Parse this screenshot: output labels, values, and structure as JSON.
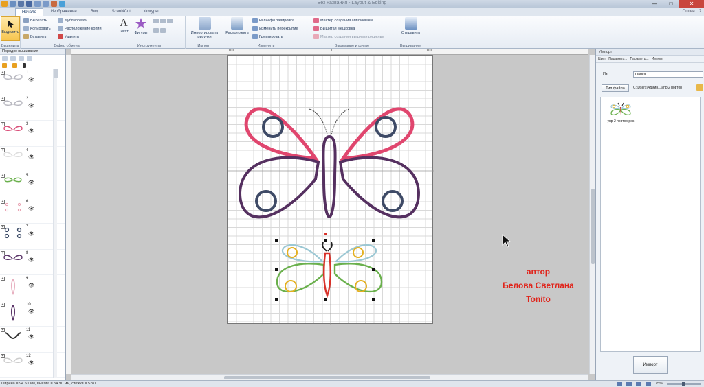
{
  "window": {
    "title": "Без названия - Layout & Editing",
    "min": "—",
    "max": "□",
    "close": "✕"
  },
  "tabs": [
    {
      "label": "Начало",
      "active": true
    },
    {
      "label": "Изображение",
      "active": false
    },
    {
      "label": "Вид",
      "active": false
    },
    {
      "label": "ScanNCut",
      "active": false
    },
    {
      "label": "Фигуры",
      "active": false
    }
  ],
  "tabs_right": {
    "options": "Опции",
    "help": "?"
  },
  "ribbon": {
    "select": {
      "label": "Выделить",
      "group": "Выделить"
    },
    "clipboard": {
      "cut": "Вырезать",
      "copy": "Копировать",
      "paste": "Вставить",
      "duplicate": "Дублировать",
      "paste_placement": "Расположение копий",
      "delete": "Удалить",
      "group": "Буфер обмена"
    },
    "tools": {
      "text": "Текст",
      "shapes": "Фигуры",
      "group": "Инструменты"
    },
    "import": {
      "label": "Импортировать рисунки",
      "group": "Импорт"
    },
    "arrange": {
      "label": "Расположить",
      "relief": "Рельеф/Гравировка",
      "change_overlap": "Изменить перекрытие",
      "group_btn": "Группировать",
      "group": "Изменить"
    },
    "cut_sew": {
      "applique": "Мастер создания аппликаций",
      "cutwork": "Вышитая мешковка",
      "cutwork_wizard": "Мастер создания вышивки ришелье",
      "group": "Вырезание и шитье"
    },
    "embroidery": {
      "send": "Отправить",
      "group": "Вышивание"
    }
  },
  "left_panel": {
    "title": "Порядок вышивания",
    "layers": [
      {
        "num": "1",
        "color": "#b8b8c0",
        "shape": "wings"
      },
      {
        "num": "2",
        "color": "#b8b8c0",
        "shape": "wings"
      },
      {
        "num": "3",
        "color": "#d9507a",
        "shape": "wings"
      },
      {
        "num": "4",
        "color": "#dddddd",
        "shape": "wings"
      },
      {
        "num": "5",
        "color": "#6ab04c",
        "shape": "wings-small"
      },
      {
        "num": "6",
        "color": "#e8a0b0",
        "shape": "dots"
      },
      {
        "num": "7",
        "color": "#3a4a66",
        "shape": "circles"
      },
      {
        "num": "8",
        "color": "#5a3468",
        "shape": "wings"
      },
      {
        "num": "9",
        "color": "#e8b0c0",
        "shape": "body"
      },
      {
        "num": "10",
        "color": "#5a3468",
        "shape": "body"
      },
      {
        "num": "11",
        "color": "#333333",
        "shape": "antenna"
      },
      {
        "num": "12",
        "color": "#cccccc",
        "shape": "wings"
      }
    ]
  },
  "ruler": {
    "left": "100",
    "center": "0",
    "right": "100"
  },
  "watermark": {
    "line1": "автор",
    "line2": "Белова Светлана",
    "line3": "Tonito"
  },
  "right_panel": {
    "title": "Импорт",
    "tabs": [
      "Цвет",
      "Параметр...",
      "Параметр...",
      "Импорт"
    ],
    "from_label": "Из",
    "from_value": "Папка",
    "file_type_btn": "Тип файла",
    "path": "C:\\Users\\Админ...\\упр 2 повтор",
    "thumb_name": "упр 2 повтор.pes",
    "import_btn": "Импорт"
  },
  "status": {
    "left": "ширина = 94.50 мм, высота = 54.90 мм, стежки = 5281",
    "zoom": "75%"
  },
  "colors": {
    "pink": "#e0466e",
    "purple": "#553060",
    "navy": "#3e4a66",
    "green": "#6ab04c",
    "yellow": "#e4b020",
    "red": "#d8322a",
    "lightblue": "#9cc8d4"
  }
}
